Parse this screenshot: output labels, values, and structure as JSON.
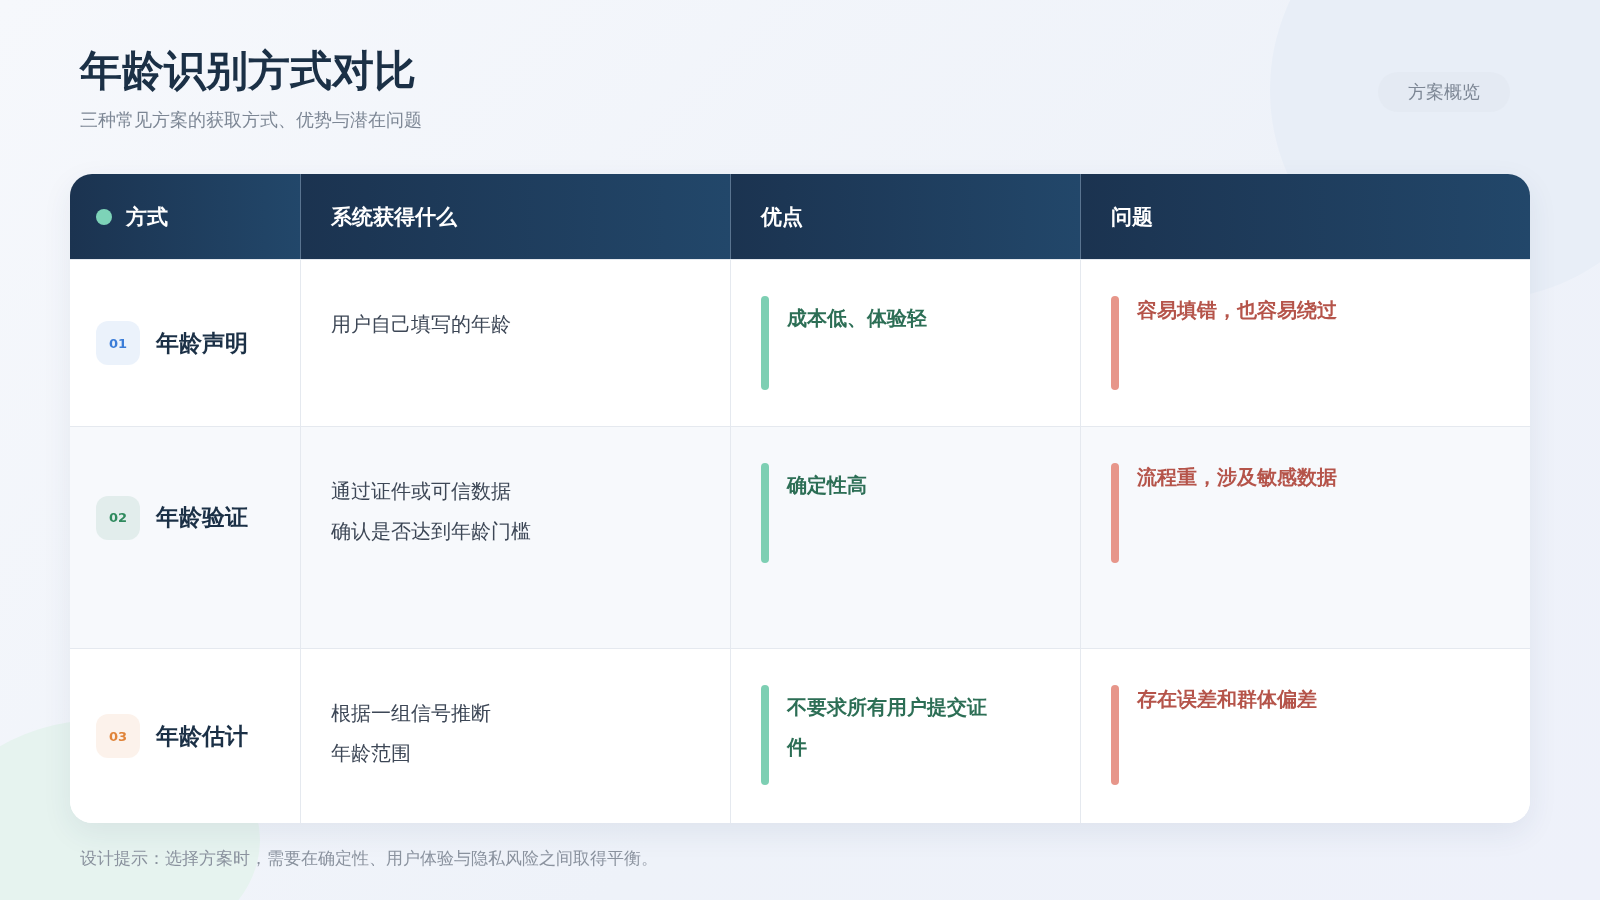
{
  "title": "年龄识别方式对比",
  "subtitle": "三种常见方案的获取方式、优势与潜在问题",
  "tag": "方案概览",
  "table": {
    "columns": [
      "方式",
      "系统获得什么",
      "优点",
      "问题"
    ],
    "rows": [
      {
        "number": "01",
        "color": "#3b7dd8",
        "name": "年龄声明",
        "obtains": [
          "用户自己填写的年龄"
        ],
        "pro": "成本低、体验轻",
        "con": "容易填错，也容易绕过"
      },
      {
        "number": "02",
        "color": "#2f8a5e",
        "name": "年龄验证",
        "obtains": [
          "通过证件或可信数据",
          "确认是否达到年龄门槛"
        ],
        "pro": "确定性高",
        "con": "流程重，涉及敏感数据"
      },
      {
        "number": "03",
        "color": "#e0843a",
        "name": "年龄估计",
        "obtains": [
          "根据一组信号推断",
          "年龄范围"
        ],
        "pro": "不要求所有用户提交证件",
        "con": "存在误差和群体偏差"
      }
    ]
  },
  "footnote": "设计提示：选择方案时，需要在确定性、用户体验与隐私风险之间取得平衡。"
}
